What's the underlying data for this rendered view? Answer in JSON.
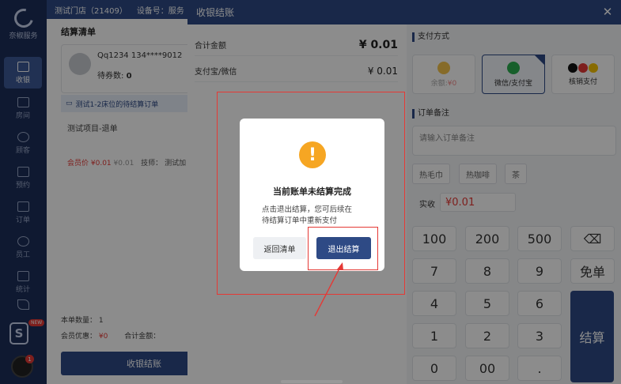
{
  "sidebar": {
    "brand": "奈椒服务",
    "items": [
      {
        "label": "收银"
      },
      {
        "label": "房间"
      },
      {
        "label": "顾客"
      },
      {
        "label": "预约"
      },
      {
        "label": "订单"
      },
      {
        "label": "员工"
      },
      {
        "label": "统计"
      }
    ],
    "app_badge_tag": "NEW",
    "avatar_dot": "1"
  },
  "topbar": {
    "store": "测试门店（21409）",
    "device": "设备号：服务"
  },
  "left_panel": {
    "title": "结算清单",
    "member_name": "Qq1234 134****9012",
    "coupon_label": "待券数:",
    "coupon_count": "0",
    "order_row": "测试1-2床位的待结算订单",
    "item_name": "测试项目-退单",
    "member_price_label": "会员价",
    "member_price": "¥0.01",
    "orig_price": "¥0.01",
    "tech_label": "技师：",
    "tech_name": "测试加",
    "qty_label": "本单数量：",
    "qty": "1",
    "discount_label": "会员优惠：",
    "discount": "¥0",
    "total_label": "合计金额：",
    "settle_btn": "收银结账"
  },
  "drawer": {
    "title": "收银结账",
    "close_glyph": "✕",
    "total_label": "合计金额",
    "total_value": "¥ 0.01",
    "alipay_label": "支付宝/微信",
    "alipay_value": "¥ 0.01",
    "pay_section": "支付方式",
    "pay_methods": [
      {
        "label_prefix": "余额:",
        "label_value": "¥0",
        "icon": "balance-icon"
      },
      {
        "label": "微信/支付宝",
        "icon": "wechat-alipay-icon"
      },
      {
        "label": "核销支付",
        "icon": "coupon-verify-icon"
      }
    ],
    "remark_section": "订单备注",
    "remark_placeholder": "请输入订单备注",
    "quick_tags": [
      "热毛巾",
      "热咖啡",
      "茶"
    ],
    "paid_label": "实收",
    "paid_value": "¥0.01",
    "keypad": [
      "100",
      "200",
      "500",
      "⌫",
      "7",
      "8",
      "9",
      "免单",
      "4",
      "5",
      "6",
      "1",
      "2",
      "3",
      "0",
      "00",
      "."
    ],
    "settle_key": "结算"
  },
  "dialog": {
    "icon_glyph": "!",
    "title": "当前账单未结算完成",
    "msg_line1": "点击退出结算，您可后续在",
    "msg_line2": "待结算订单中重新支付",
    "back_btn": "返回清单",
    "exit_btn": "退出结算"
  },
  "colors": {
    "primary": "#2e4a85",
    "sidebar": "#1c2f5a",
    "warning": "#f6a623",
    "annotation": "#e53935"
  }
}
